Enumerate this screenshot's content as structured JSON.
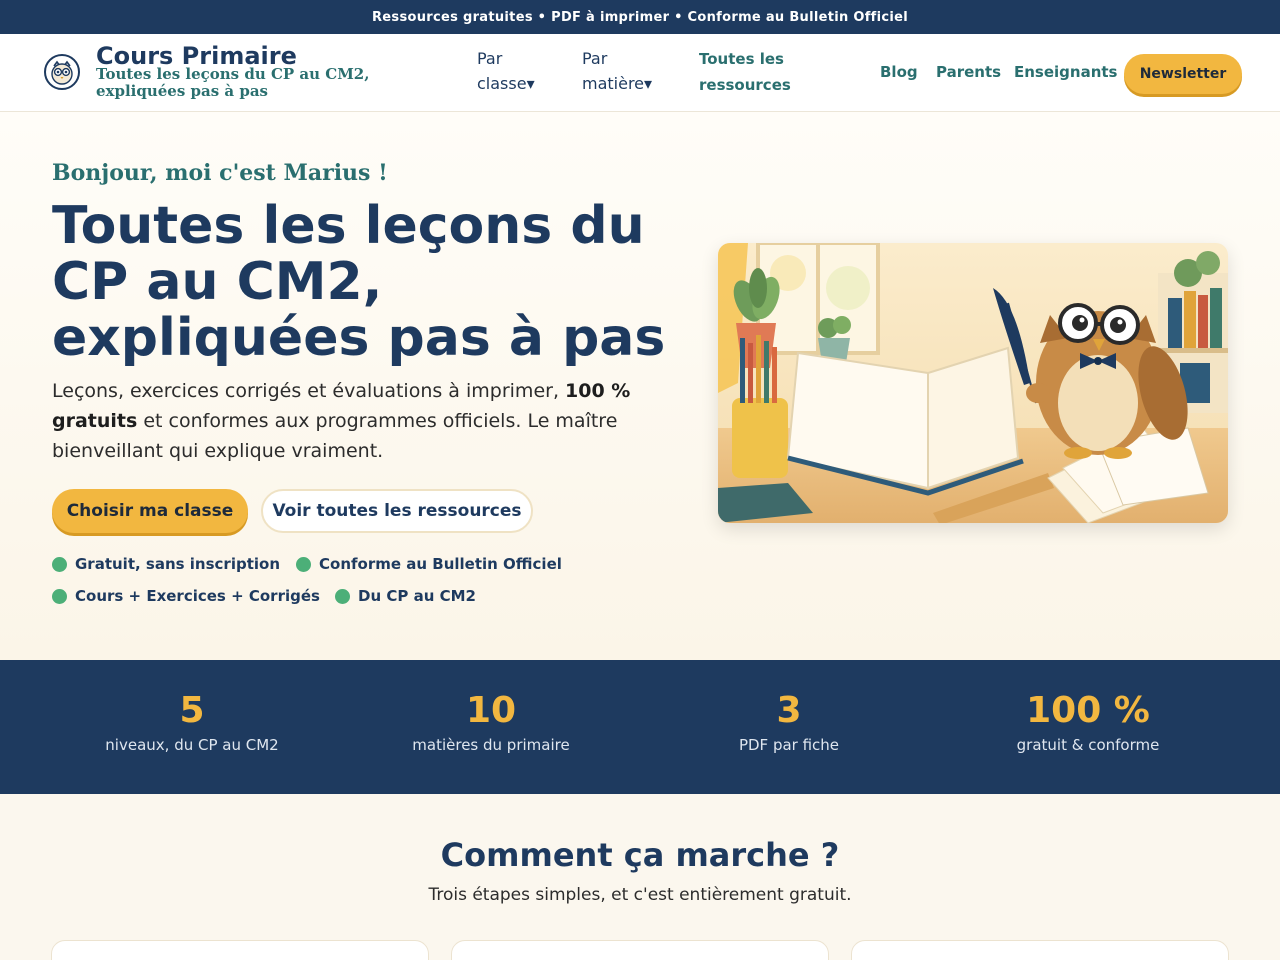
{
  "topbar": {
    "text": "Ressources gratuites • PDF à imprimer • Conforme au Bulletin Officiel"
  },
  "header": {
    "brand_title": "Cours Primaire",
    "brand_subtitle": "Toutes les leçons du CP au CM2, expliquées pas à pas",
    "nav": {
      "par_classe": "Par classe▾",
      "par_matiere": "Par matière▾",
      "toutes_ressources": "Toutes les ressources",
      "blog": "Blog",
      "parents": "Parents",
      "enseignants": "Enseignants"
    },
    "newsletter_label": "Newsletter"
  },
  "hero": {
    "greeting": "Bonjour, moi c'est Marius !",
    "title": "Toutes les leçons du CP au CM2, expliquées pas à pas",
    "lead_before": "Leçons, exercices corrigés et évaluations à imprimer, ",
    "lead_bold": "100 % gratuits",
    "lead_after": " et conformes aux programmes officiels. Le maître bienveillant qui explique vraiment.",
    "primary_cta": "Choisir ma classe",
    "secondary_cta": "Voir toutes les ressources",
    "checks": [
      "Gratuit, sans inscription",
      "Conforme au Bulletin Officiel",
      "Cours + Exercices + Corrigés",
      "Du CP au CM2"
    ]
  },
  "stats": [
    {
      "value": "5",
      "label": "niveaux, du CP au CM2"
    },
    {
      "value": "10",
      "label": "matières du primaire"
    },
    {
      "value": "3",
      "label": "PDF par fiche"
    },
    {
      "value": "100 %",
      "label": "gratuit & conforme"
    }
  ],
  "how": {
    "title": "Comment ça marche ?",
    "subtitle": "Trois étapes simples, et c'est entièrement gratuit."
  },
  "colors": {
    "navy": "#1e3a5f",
    "accent": "#f2b740",
    "teal": "#2a6f6f",
    "check_green": "#4caf78",
    "background": "#fbf7ee"
  }
}
